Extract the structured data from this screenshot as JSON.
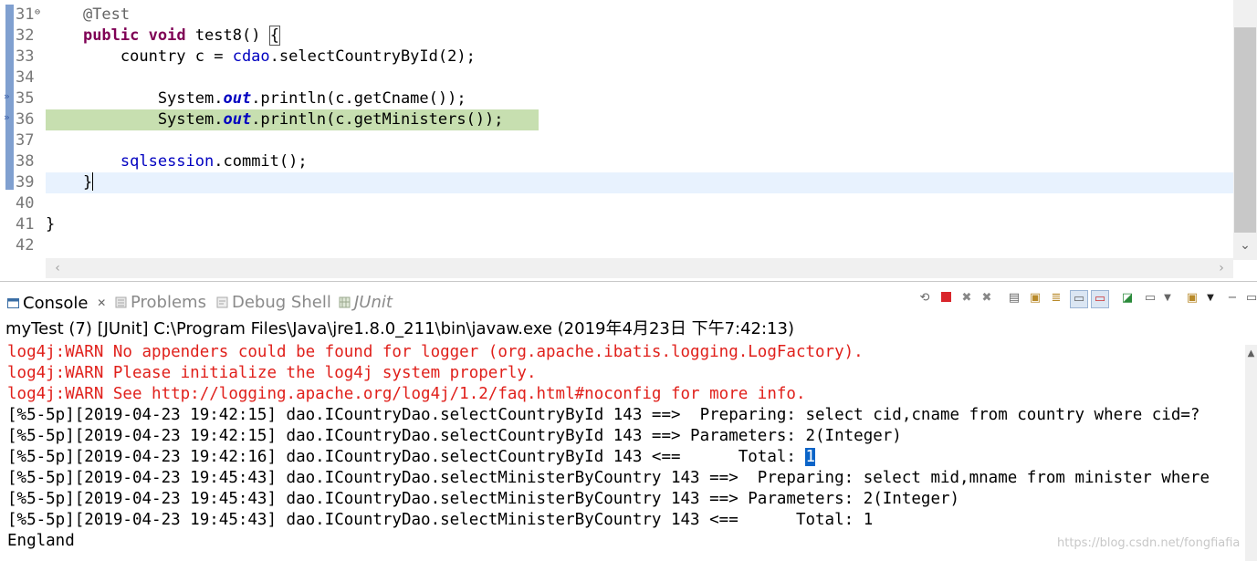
{
  "editor": {
    "lines": [
      {
        "num": "31",
        "segments": [
          {
            "t": "    "
          },
          {
            "t": "@Test",
            "c": "ann"
          }
        ],
        "fold": true
      },
      {
        "num": "32",
        "segments": [
          {
            "t": "    "
          },
          {
            "t": "public",
            "c": "kw"
          },
          {
            "t": " "
          },
          {
            "t": "void",
            "c": "kw"
          },
          {
            "t": " test8() "
          },
          {
            "t": "{",
            "c": "brace"
          }
        ]
      },
      {
        "num": "33",
        "segments": [
          {
            "t": "        country c = "
          },
          {
            "t": "cdao",
            "c": "fld"
          },
          {
            "t": ".selectCountryById(2);"
          }
        ]
      },
      {
        "num": "34",
        "segments": []
      },
      {
        "num": "35",
        "segments": [
          {
            "t": "            System."
          },
          {
            "t": "out",
            "c": "sfld"
          },
          {
            "t": ".println(c.getCname());"
          }
        ],
        "marker": true
      },
      {
        "num": "36",
        "segments": [
          {
            "t": "            System."
          },
          {
            "t": "out",
            "c": "sfld"
          },
          {
            "t": ".println(c.getMinisters());"
          }
        ],
        "marker": true,
        "highlight": "green"
      },
      {
        "num": "37",
        "segments": []
      },
      {
        "num": "38",
        "segments": [
          {
            "t": "        "
          },
          {
            "t": "sqlsession",
            "c": "fld"
          },
          {
            "t": ".commit();"
          }
        ]
      },
      {
        "num": "39",
        "segments": [
          {
            "t": "    }"
          },
          {
            "t": "",
            "c": "caret"
          }
        ],
        "highlight": "current"
      },
      {
        "num": "40",
        "segments": []
      },
      {
        "num": "41",
        "segments": [
          {
            "t": "}"
          }
        ]
      },
      {
        "num": "42",
        "segments": []
      }
    ]
  },
  "tabs": [
    {
      "label": "Console",
      "active": true,
      "icon": "console-icon",
      "close": "✕"
    },
    {
      "label": "Problems",
      "active": false,
      "icon": "problems-icon"
    },
    {
      "label": "Debug Shell",
      "active": false,
      "icon": "debug-shell-icon"
    },
    {
      "label": "JUnit",
      "active": false,
      "icon": "junit-icon"
    }
  ],
  "console": {
    "description": "myTest (7) [JUnit] C:\\Program Files\\Java\\jre1.8.0_211\\bin\\javaw.exe (2019年4月23日 下午7:42:13)",
    "lines": [
      {
        "text": "log4j:WARN No appenders could be found for logger (org.apache.ibatis.logging.LogFactory).",
        "kind": "err"
      },
      {
        "text": "log4j:WARN Please initialize the log4j system properly.",
        "kind": "err"
      },
      {
        "text": "log4j:WARN See http://logging.apache.org/log4j/1.2/faq.html#noconfig for more info.",
        "kind": "err"
      },
      {
        "text": "[%5-5p][2019-04-23 19:42:15] dao.ICountryDao.selectCountryById 143 ==>  Preparing: select cid,cname from country where cid=?",
        "kind": "out"
      },
      {
        "text": "[%5-5p][2019-04-23 19:42:15] dao.ICountryDao.selectCountryById 143 ==> Parameters: 2(Integer)",
        "kind": "out"
      },
      {
        "text": "[%5-5p][2019-04-23 19:42:16] dao.ICountryDao.selectCountryById 143 <==      Total: ",
        "kind": "out",
        "selected": "1"
      },
      {
        "text": "[%5-5p][2019-04-23 19:45:43] dao.ICountryDao.selectMinisterByCountry 143 ==>  Preparing: select mid,mname from minister where",
        "kind": "out"
      },
      {
        "text": "[%5-5p][2019-04-23 19:45:43] dao.ICountryDao.selectMinisterByCountry 143 ==> Parameters: 2(Integer)",
        "kind": "out"
      },
      {
        "text": "[%5-5p][2019-04-23 19:45:43] dao.ICountryDao.selectMinisterByCountry 143 <==      Total: 1",
        "kind": "out"
      },
      {
        "text": "England",
        "kind": "out"
      }
    ]
  },
  "toolbar": {
    "icons": [
      "pin-icon",
      "terminate-icon",
      "remove-launch-icon",
      "remove-all-icon",
      "clear-console-icon",
      "scroll-lock-icon",
      "word-wrap-icon",
      "show-stdout-icon",
      "show-stderr-icon",
      "pin-console-icon",
      "display-console-icon",
      "display-console-dropdown-icon",
      "open-console-icon",
      "open-console-dropdown-icon",
      "minimize-icon",
      "maximize-icon"
    ]
  },
  "watermark": "https://blog.csdn.net/fongfiafia"
}
